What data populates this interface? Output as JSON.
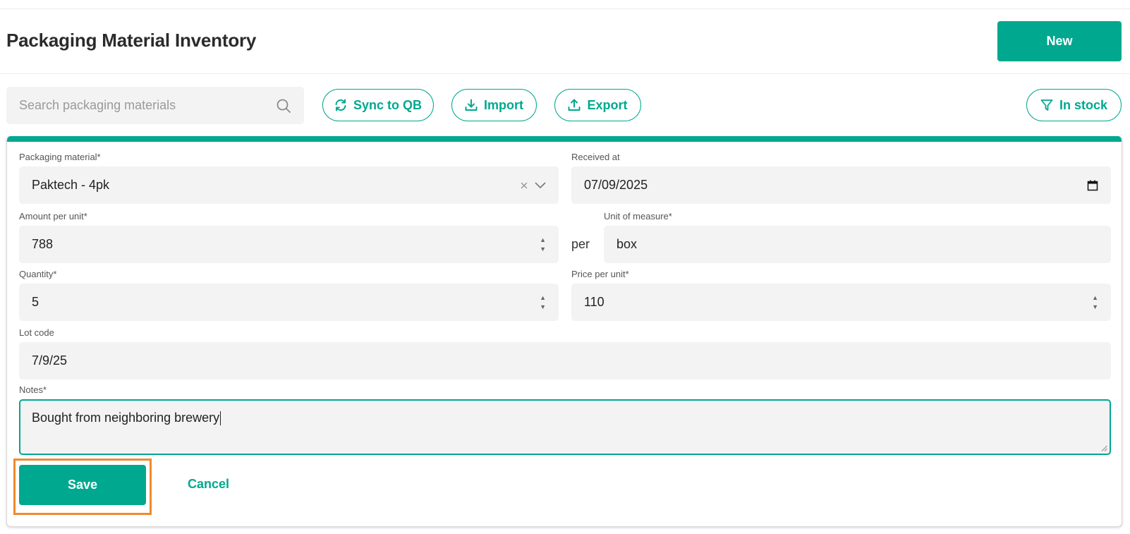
{
  "header": {
    "title": "Packaging Material Inventory",
    "new_label": "New"
  },
  "toolbar": {
    "search_placeholder": "Search packaging materials",
    "sync_label": "Sync to QB",
    "import_label": "Import",
    "export_label": "Export",
    "filter_label": "In stock",
    "search_icon": "search-icon",
    "sync_icon": "refresh-icon",
    "import_icon": "download-icon",
    "export_icon": "upload-icon",
    "filter_icon": "filter-icon"
  },
  "form": {
    "packaging_material": {
      "label": "Packaging material*",
      "value": "Paktech - 4pk"
    },
    "received_at": {
      "label": "Received at",
      "value": "07/09/2025"
    },
    "amount_per_unit": {
      "label": "Amount per unit*",
      "value": "788"
    },
    "per_text": "per",
    "unit_of_measure": {
      "label": "Unit of measure*",
      "value": "box"
    },
    "quantity": {
      "label": "Quantity*",
      "value": "5"
    },
    "price_per_unit": {
      "label": "Price per unit*",
      "value": "110"
    },
    "lot_code": {
      "label": "Lot code",
      "value": "7/9/25"
    },
    "notes": {
      "label": "Notes*",
      "value": "Bought from neighboring brewery"
    },
    "save_label": "Save",
    "cancel_label": "Cancel"
  },
  "colors": {
    "accent": "#00a88f",
    "highlight": "#f08a2e",
    "field_bg": "#f3f3f3"
  }
}
